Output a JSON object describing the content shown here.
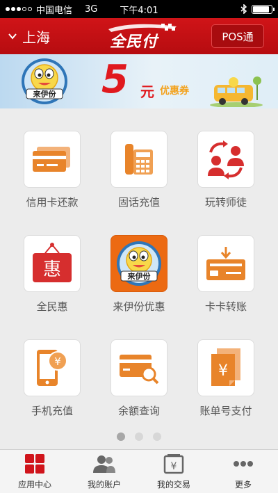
{
  "status": {
    "carrier": "中国电信",
    "network": "3G",
    "time": "下午4:01",
    "battery_level": 0.9
  },
  "header": {
    "city": "上海",
    "logo": "全民付",
    "pos_button": "POS通"
  },
  "banner": {
    "brand": "来伊份",
    "amount": "5",
    "unit": "元",
    "coupon": "优惠券"
  },
  "apps": [
    {
      "label": "信用卡还款",
      "icon": "credit-card-icon"
    },
    {
      "label": "固话充值",
      "icon": "landline-phone-icon"
    },
    {
      "label": "玩转师徒",
      "icon": "mentor-exchange-icon"
    },
    {
      "label": "全民惠",
      "icon": "discount-sign-icon"
    },
    {
      "label": "来伊份优惠",
      "icon": "laiyifen-logo-icon"
    },
    {
      "label": "卡卡转账",
      "icon": "card-transfer-icon"
    },
    {
      "label": "手机充值",
      "icon": "mobile-recharge-icon"
    },
    {
      "label": "余额查询",
      "icon": "balance-query-icon"
    },
    {
      "label": "账单号支付",
      "icon": "bill-payment-icon"
    }
  ],
  "pager": {
    "pages": 3,
    "current": 1
  },
  "tabs": [
    {
      "label": "应用中心",
      "icon": "app-center-icon",
      "active": true
    },
    {
      "label": "我的账户",
      "icon": "account-icon",
      "active": false
    },
    {
      "label": "我的交易",
      "icon": "transactions-icon",
      "active": false
    },
    {
      "label": "更多",
      "icon": "more-icon",
      "active": false
    }
  ],
  "colors": {
    "brand_red": "#c8102e",
    "icon_orange": "#e8842a",
    "icon_red": "#d62e2e"
  }
}
